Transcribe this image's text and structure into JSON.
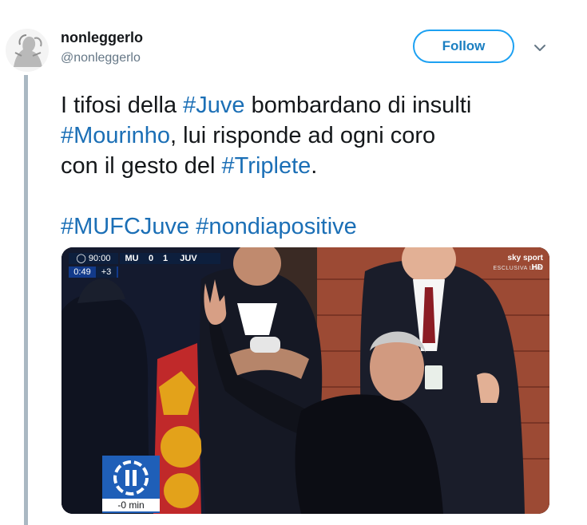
{
  "tweet": {
    "author": {
      "display_name": "nonleggerlo",
      "handle": "@nonleggerlo"
    },
    "follow_label": "Follow",
    "text": {
      "line1_a": "I tifosi della ",
      "line1_tag": "#Juve",
      "line1_b": " bombardano di insulti",
      "line2_tag": "#Mourinho",
      "line2_b": ", lui risponde ad ogni coro",
      "line3_a": "con il gesto del ",
      "line3_tag": "#Triplete",
      "line3_b": ".",
      "tags_line": [
        "#MUFCJuve",
        "#nondiapositive"
      ]
    }
  },
  "media": {
    "scoreboard": {
      "time": "90:00",
      "stoppage_elapsed": "0:49",
      "stoppage_added": "+3",
      "home": "MU",
      "home_score": "0",
      "away_score": "1",
      "away": "JUV"
    },
    "channel": {
      "logo": "sky sport HD",
      "subtitle": "ESCLUSIVA LIVE"
    },
    "player_overlay": {
      "label": "-0 min"
    }
  },
  "colors": {
    "link": "#1b6fb6",
    "follow_border": "#1da1f2",
    "thread_line": "#aab8c2"
  }
}
